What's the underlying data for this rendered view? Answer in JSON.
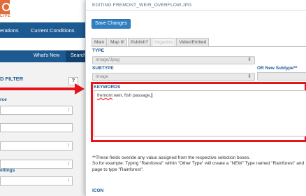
{
  "background": {
    "logo_text": "LIVE",
    "nav": {
      "item1": "erations",
      "item2": "Current Conditions"
    },
    "subnav": {
      "whats_new": "What's New",
      "search": "Search"
    },
    "panel": {
      "filter_title": "D FILTER",
      "help": "?",
      "source_label": "rce",
      "settings_label": "ettings"
    }
  },
  "modal": {
    "title": "EDITING FREMONT_WEIR_OVERFLOW.JPG",
    "save_label": "Save Changes",
    "tabs": [
      "Main",
      "Map It!",
      "Publish?",
      "Organize",
      "Video/Embed"
    ],
    "type": {
      "label": "TYPE",
      "value": "Image/Jpeg"
    },
    "subtype": {
      "label": "SUBTYPE",
      "value": "Image",
      "or_new_label": "OR New Subtype**"
    },
    "keywords": {
      "label": "KEYWORDS",
      "value_part1": "fremont",
      "value_part2": " weir, fish passage,"
    },
    "note_line1": "**These fields overide any value assigned from the respective selection boxes.",
    "note_line2": "So for example: Typing \"Rainforest\" within \"Other Type\" will create a \"NEW\" Type named \"Rainforest\" and",
    "note_line3": "page to type \"Rainforest\".",
    "icon_label": "ICON"
  },
  "colors": {
    "accent_blue": "#1d5a91",
    "highlight_red": "#e8141c",
    "button_blue": "#2f7fc1",
    "logo_orange": "#e06b3b"
  }
}
